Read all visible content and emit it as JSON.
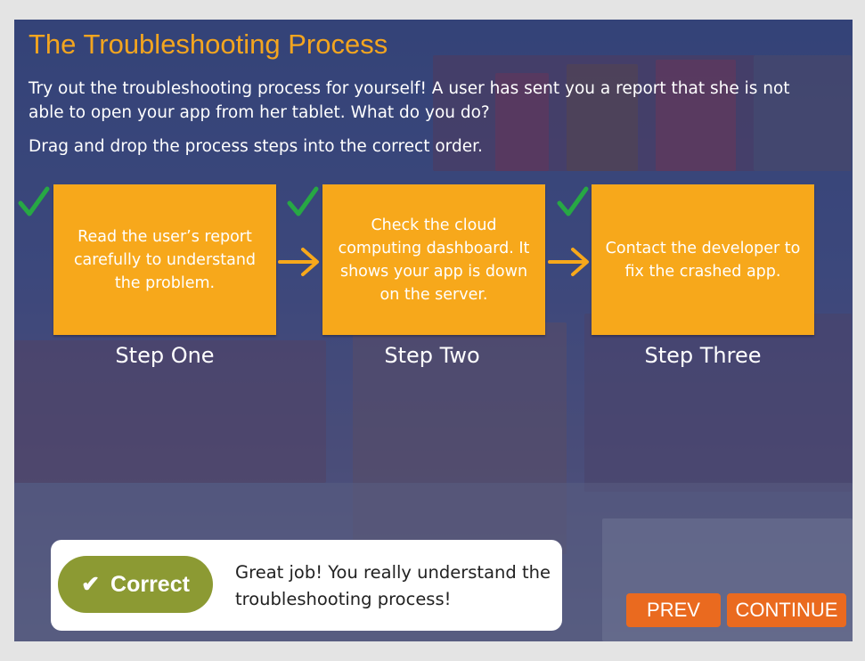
{
  "title": "The Troubleshooting Process",
  "intro": "Try out the troubleshooting process for yourself! A user has sent you a report that she is not able to open your app from her tablet. What do you do?",
  "instruction": "Drag and drop the process steps into the correct order.",
  "steps": [
    {
      "text": "Read the user’s report carefully to understand the problem.",
      "label": "Step One"
    },
    {
      "text": "Check the cloud computing dashboard. It shows your app is down on the server.",
      "label": "Step Two"
    },
    {
      "text": "Contact the developer to fix the crashed app.",
      "label": "Step Three"
    }
  ],
  "feedback": {
    "badge": "Correct",
    "badge_icon": "✔",
    "message": "Great job! You really understand the troubleshooting process!"
  },
  "nav": {
    "prev": "PREV",
    "continue": "CONTINUE"
  },
  "colors": {
    "title": "#f3a51f",
    "card": "#f7a81b",
    "check": "#27a844",
    "arrow": "#f7a81b",
    "correct_badge": "#8c9a33",
    "nav_button": "#ea6a1f"
  }
}
